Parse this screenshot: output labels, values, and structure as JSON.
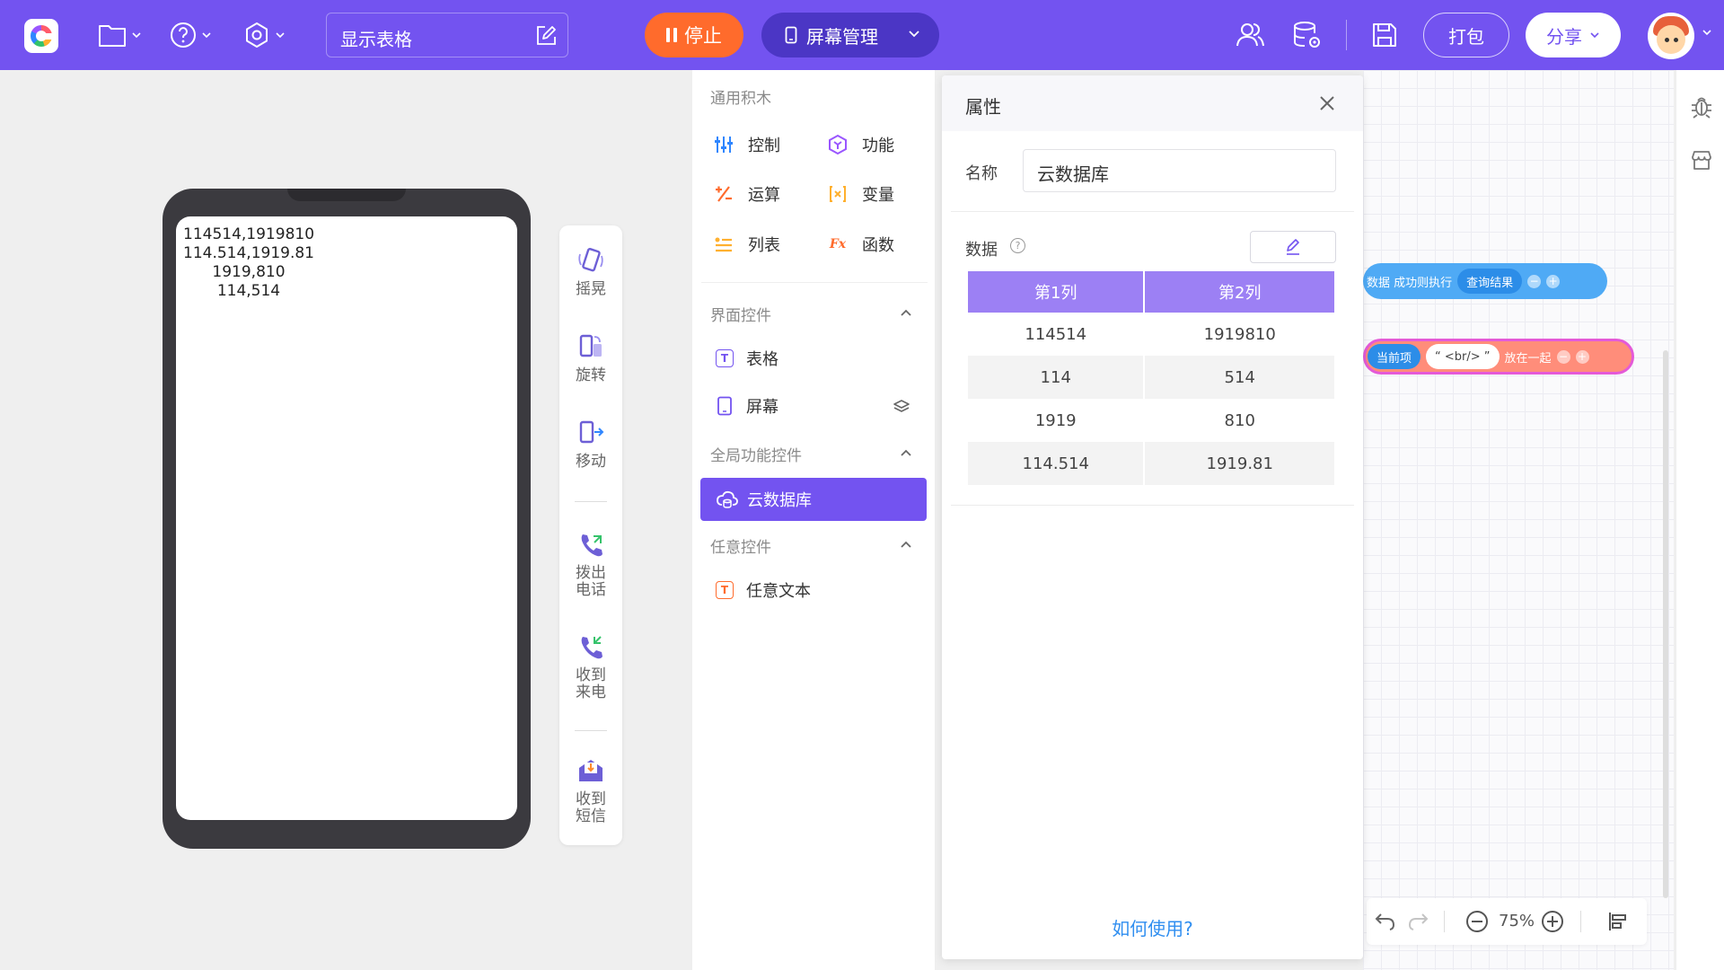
{
  "topbar": {
    "project_name": "显示表格",
    "stop_label": "停止",
    "screen_manage_label": "屏幕管理",
    "pack_label": "打包",
    "share_label": "分享"
  },
  "simulator": {
    "lines": [
      "114514,1919810",
      "114.514,1919.81",
      "      1919,810",
      "       114,514"
    ],
    "tools": [
      {
        "label": "摇晃",
        "icon": "shake-icon"
      },
      {
        "label": "旋转",
        "icon": "rotate-icon"
      },
      {
        "label": "移动",
        "icon": "move-icon"
      },
      {
        "label": "拨出\n电话",
        "icon": "call-out-icon"
      },
      {
        "label": "收到\n来电",
        "icon": "incoming-call-icon"
      },
      {
        "label": "收到\n短信",
        "icon": "sms-icon"
      }
    ]
  },
  "blocks": {
    "general_title": "通用积木",
    "general": [
      {
        "label": "控制",
        "icon": "sliders-icon",
        "color": "#2f86ff"
      },
      {
        "label": "功能",
        "icon": "hexagon-icon",
        "color": "#9a56ff"
      },
      {
        "label": "运算",
        "icon": "calc-icon",
        "color": "#ff6b2c"
      },
      {
        "label": "变量",
        "icon": "variable-icon",
        "color": "#ffb02e"
      },
      {
        "label": "列表",
        "icon": "list-icon",
        "color": "#ffb02e"
      },
      {
        "label": "函数",
        "icon": "fx-icon",
        "color": "#ff6b2c"
      }
    ],
    "ui_title": "界面控件",
    "ui": [
      {
        "label": "表格",
        "icon": "table-icon"
      },
      {
        "label": "屏幕",
        "icon": "screen-icon"
      }
    ],
    "global_title": "全局功能控件",
    "global": [
      {
        "label": "云数据库",
        "icon": "cloud-db-icon"
      }
    ],
    "any_title": "任意控件",
    "any": [
      {
        "label": "任意文本",
        "icon": "text-icon"
      }
    ]
  },
  "properties": {
    "title": "属性",
    "name_label": "名称",
    "name_value": "云数据库",
    "data_label": "数据",
    "columns": [
      "第1列",
      "第2列"
    ],
    "rows": [
      [
        "114514",
        "1919810"
      ],
      [
        "114",
        "514"
      ],
      [
        "1919",
        "810"
      ],
      [
        "114.514",
        "1919.81"
      ]
    ],
    "help_link": "如何使用?"
  },
  "workspace": {
    "block1": {
      "text": "数据  成功则执行",
      "pill": "查询结果"
    },
    "block2": {
      "left": "当前项",
      "pill": "“ <br/> ”",
      "right": "放在一起"
    },
    "zoom": "75%"
  },
  "colors": {
    "accent": "#7353f0",
    "stop": "#ff6b2c",
    "table_header": "#9c80f4",
    "link": "#2f8ef0"
  }
}
